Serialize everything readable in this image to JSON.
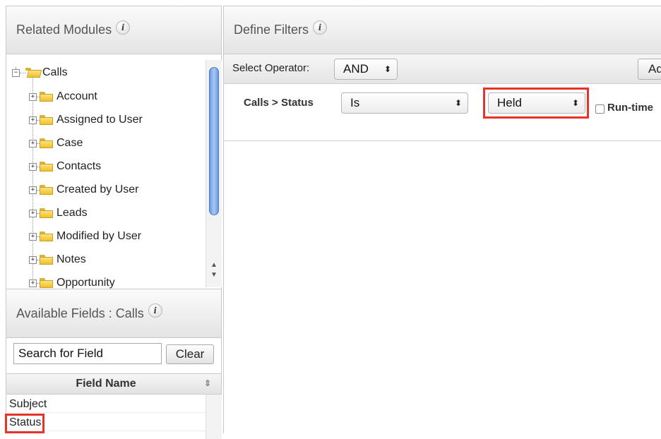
{
  "related_modules": {
    "title": "Related Modules",
    "info_icon": "i",
    "tree": {
      "root": {
        "label": "Calls",
        "icon": "folder-open-icon",
        "expander": "−"
      },
      "children": [
        {
          "label": "Account",
          "expander": "+"
        },
        {
          "label": "Assigned to User",
          "expander": "+"
        },
        {
          "label": "Case",
          "expander": "+"
        },
        {
          "label": "Contacts",
          "expander": "+"
        },
        {
          "label": "Created by User",
          "expander": "+"
        },
        {
          "label": "Leads",
          "expander": "+"
        },
        {
          "label": "Modified by User",
          "expander": "+"
        },
        {
          "label": "Notes",
          "expander": "+"
        },
        {
          "label": "Opportunity",
          "expander": "+"
        }
      ]
    },
    "scroll_up": "▲",
    "scroll_down": "▼"
  },
  "available_fields": {
    "title": "Available Fields : Calls",
    "info_icon": "i",
    "search_value": "Search for Field",
    "clear_label": "Clear",
    "column_header": "Field Name",
    "sort_icon": "⇕",
    "rows": [
      "Subject",
      "Status"
    ],
    "highlighted_row": "Status"
  },
  "define_filters": {
    "title": "Define Filters",
    "info_icon": "i",
    "operator_label": "Select Operator:",
    "operator_value": "AND",
    "select_arrow": "⬍",
    "add_label": "Ad",
    "filter": {
      "field_label": "Calls > Status",
      "comparator": "Is",
      "value": "Held",
      "runtime_label": "Run-time"
    }
  },
  "colors": {
    "highlight": "#e8332a",
    "scroll_thumb": "#7aa6e6"
  }
}
